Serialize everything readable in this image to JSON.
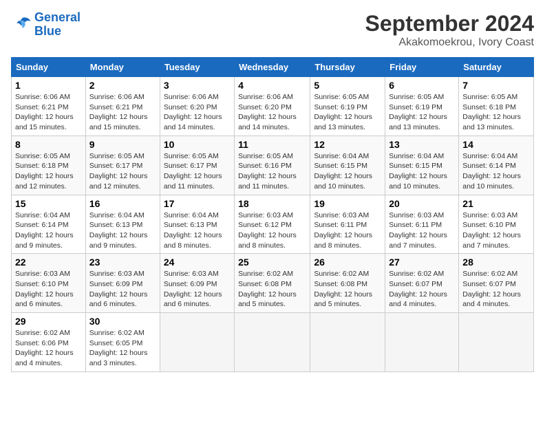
{
  "header": {
    "logo_line1": "General",
    "logo_line2": "Blue",
    "month_title": "September 2024",
    "location": "Akakomoekrou, Ivory Coast"
  },
  "columns": [
    "Sunday",
    "Monday",
    "Tuesday",
    "Wednesday",
    "Thursday",
    "Friday",
    "Saturday"
  ],
  "weeks": [
    [
      {
        "day": "1",
        "sunrise": "Sunrise: 6:06 AM",
        "sunset": "Sunset: 6:21 PM",
        "daylight": "Daylight: 12 hours and 15 minutes."
      },
      {
        "day": "2",
        "sunrise": "Sunrise: 6:06 AM",
        "sunset": "Sunset: 6:21 PM",
        "daylight": "Daylight: 12 hours and 15 minutes."
      },
      {
        "day": "3",
        "sunrise": "Sunrise: 6:06 AM",
        "sunset": "Sunset: 6:20 PM",
        "daylight": "Daylight: 12 hours and 14 minutes."
      },
      {
        "day": "4",
        "sunrise": "Sunrise: 6:06 AM",
        "sunset": "Sunset: 6:20 PM",
        "daylight": "Daylight: 12 hours and 14 minutes."
      },
      {
        "day": "5",
        "sunrise": "Sunrise: 6:05 AM",
        "sunset": "Sunset: 6:19 PM",
        "daylight": "Daylight: 12 hours and 13 minutes."
      },
      {
        "day": "6",
        "sunrise": "Sunrise: 6:05 AM",
        "sunset": "Sunset: 6:19 PM",
        "daylight": "Daylight: 12 hours and 13 minutes."
      },
      {
        "day": "7",
        "sunrise": "Sunrise: 6:05 AM",
        "sunset": "Sunset: 6:18 PM",
        "daylight": "Daylight: 12 hours and 13 minutes."
      }
    ],
    [
      {
        "day": "8",
        "sunrise": "Sunrise: 6:05 AM",
        "sunset": "Sunset: 6:18 PM",
        "daylight": "Daylight: 12 hours and 12 minutes."
      },
      {
        "day": "9",
        "sunrise": "Sunrise: 6:05 AM",
        "sunset": "Sunset: 6:17 PM",
        "daylight": "Daylight: 12 hours and 12 minutes."
      },
      {
        "day": "10",
        "sunrise": "Sunrise: 6:05 AM",
        "sunset": "Sunset: 6:17 PM",
        "daylight": "Daylight: 12 hours and 11 minutes."
      },
      {
        "day": "11",
        "sunrise": "Sunrise: 6:05 AM",
        "sunset": "Sunset: 6:16 PM",
        "daylight": "Daylight: 12 hours and 11 minutes."
      },
      {
        "day": "12",
        "sunrise": "Sunrise: 6:04 AM",
        "sunset": "Sunset: 6:15 PM",
        "daylight": "Daylight: 12 hours and 10 minutes."
      },
      {
        "day": "13",
        "sunrise": "Sunrise: 6:04 AM",
        "sunset": "Sunset: 6:15 PM",
        "daylight": "Daylight: 12 hours and 10 minutes."
      },
      {
        "day": "14",
        "sunrise": "Sunrise: 6:04 AM",
        "sunset": "Sunset: 6:14 PM",
        "daylight": "Daylight: 12 hours and 10 minutes."
      }
    ],
    [
      {
        "day": "15",
        "sunrise": "Sunrise: 6:04 AM",
        "sunset": "Sunset: 6:14 PM",
        "daylight": "Daylight: 12 hours and 9 minutes."
      },
      {
        "day": "16",
        "sunrise": "Sunrise: 6:04 AM",
        "sunset": "Sunset: 6:13 PM",
        "daylight": "Daylight: 12 hours and 9 minutes."
      },
      {
        "day": "17",
        "sunrise": "Sunrise: 6:04 AM",
        "sunset": "Sunset: 6:13 PM",
        "daylight": "Daylight: 12 hours and 8 minutes."
      },
      {
        "day": "18",
        "sunrise": "Sunrise: 6:03 AM",
        "sunset": "Sunset: 6:12 PM",
        "daylight": "Daylight: 12 hours and 8 minutes."
      },
      {
        "day": "19",
        "sunrise": "Sunrise: 6:03 AM",
        "sunset": "Sunset: 6:11 PM",
        "daylight": "Daylight: 12 hours and 8 minutes."
      },
      {
        "day": "20",
        "sunrise": "Sunrise: 6:03 AM",
        "sunset": "Sunset: 6:11 PM",
        "daylight": "Daylight: 12 hours and 7 minutes."
      },
      {
        "day": "21",
        "sunrise": "Sunrise: 6:03 AM",
        "sunset": "Sunset: 6:10 PM",
        "daylight": "Daylight: 12 hours and 7 minutes."
      }
    ],
    [
      {
        "day": "22",
        "sunrise": "Sunrise: 6:03 AM",
        "sunset": "Sunset: 6:10 PM",
        "daylight": "Daylight: 12 hours and 6 minutes."
      },
      {
        "day": "23",
        "sunrise": "Sunrise: 6:03 AM",
        "sunset": "Sunset: 6:09 PM",
        "daylight": "Daylight: 12 hours and 6 minutes."
      },
      {
        "day": "24",
        "sunrise": "Sunrise: 6:03 AM",
        "sunset": "Sunset: 6:09 PM",
        "daylight": "Daylight: 12 hours and 6 minutes."
      },
      {
        "day": "25",
        "sunrise": "Sunrise: 6:02 AM",
        "sunset": "Sunset: 6:08 PM",
        "daylight": "Daylight: 12 hours and 5 minutes."
      },
      {
        "day": "26",
        "sunrise": "Sunrise: 6:02 AM",
        "sunset": "Sunset: 6:08 PM",
        "daylight": "Daylight: 12 hours and 5 minutes."
      },
      {
        "day": "27",
        "sunrise": "Sunrise: 6:02 AM",
        "sunset": "Sunset: 6:07 PM",
        "daylight": "Daylight: 12 hours and 4 minutes."
      },
      {
        "day": "28",
        "sunrise": "Sunrise: 6:02 AM",
        "sunset": "Sunset: 6:07 PM",
        "daylight": "Daylight: 12 hours and 4 minutes."
      }
    ],
    [
      {
        "day": "29",
        "sunrise": "Sunrise: 6:02 AM",
        "sunset": "Sunset: 6:06 PM",
        "daylight": "Daylight: 12 hours and 4 minutes."
      },
      {
        "day": "30",
        "sunrise": "Sunrise: 6:02 AM",
        "sunset": "Sunset: 6:05 PM",
        "daylight": "Daylight: 12 hours and 3 minutes."
      },
      null,
      null,
      null,
      null,
      null
    ]
  ]
}
